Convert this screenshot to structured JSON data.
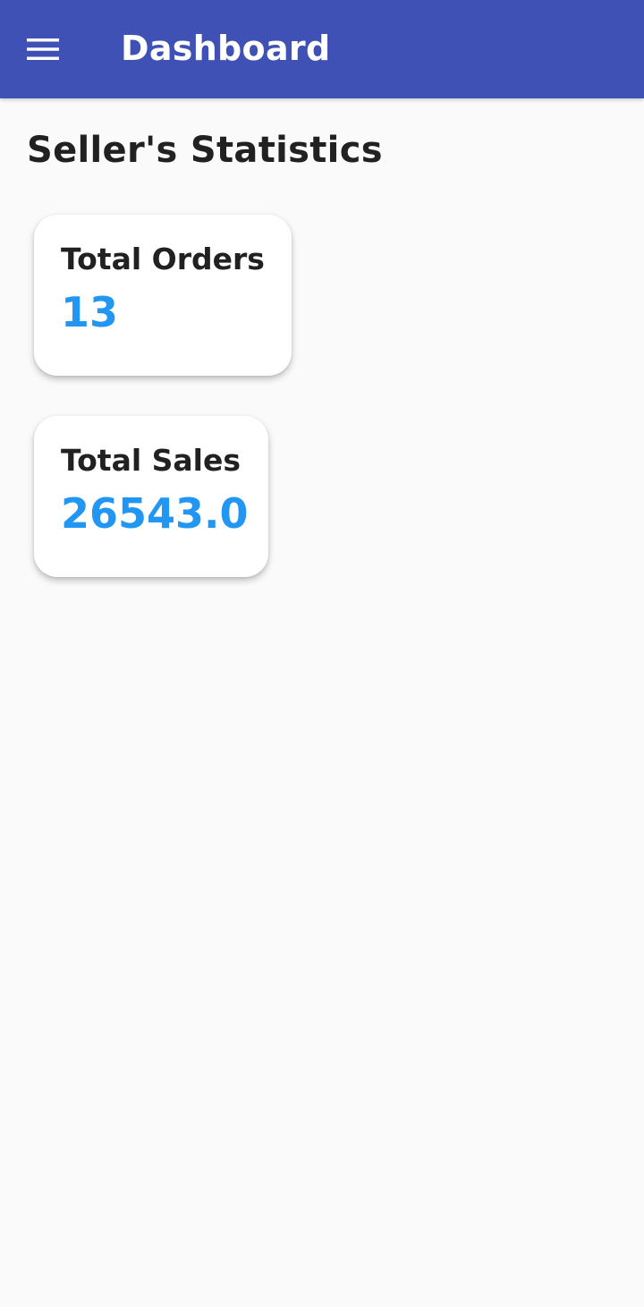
{
  "app_bar": {
    "title": "Dashboard",
    "menu_icon": "menu-icon",
    "background_color": "#3f51b5"
  },
  "main": {
    "section_title": "Seller's Statistics",
    "stats": [
      {
        "label": "Total Orders",
        "value": "13"
      },
      {
        "label": "Total Sales",
        "value": "26543.0"
      }
    ],
    "value_color": "#2196f3"
  }
}
